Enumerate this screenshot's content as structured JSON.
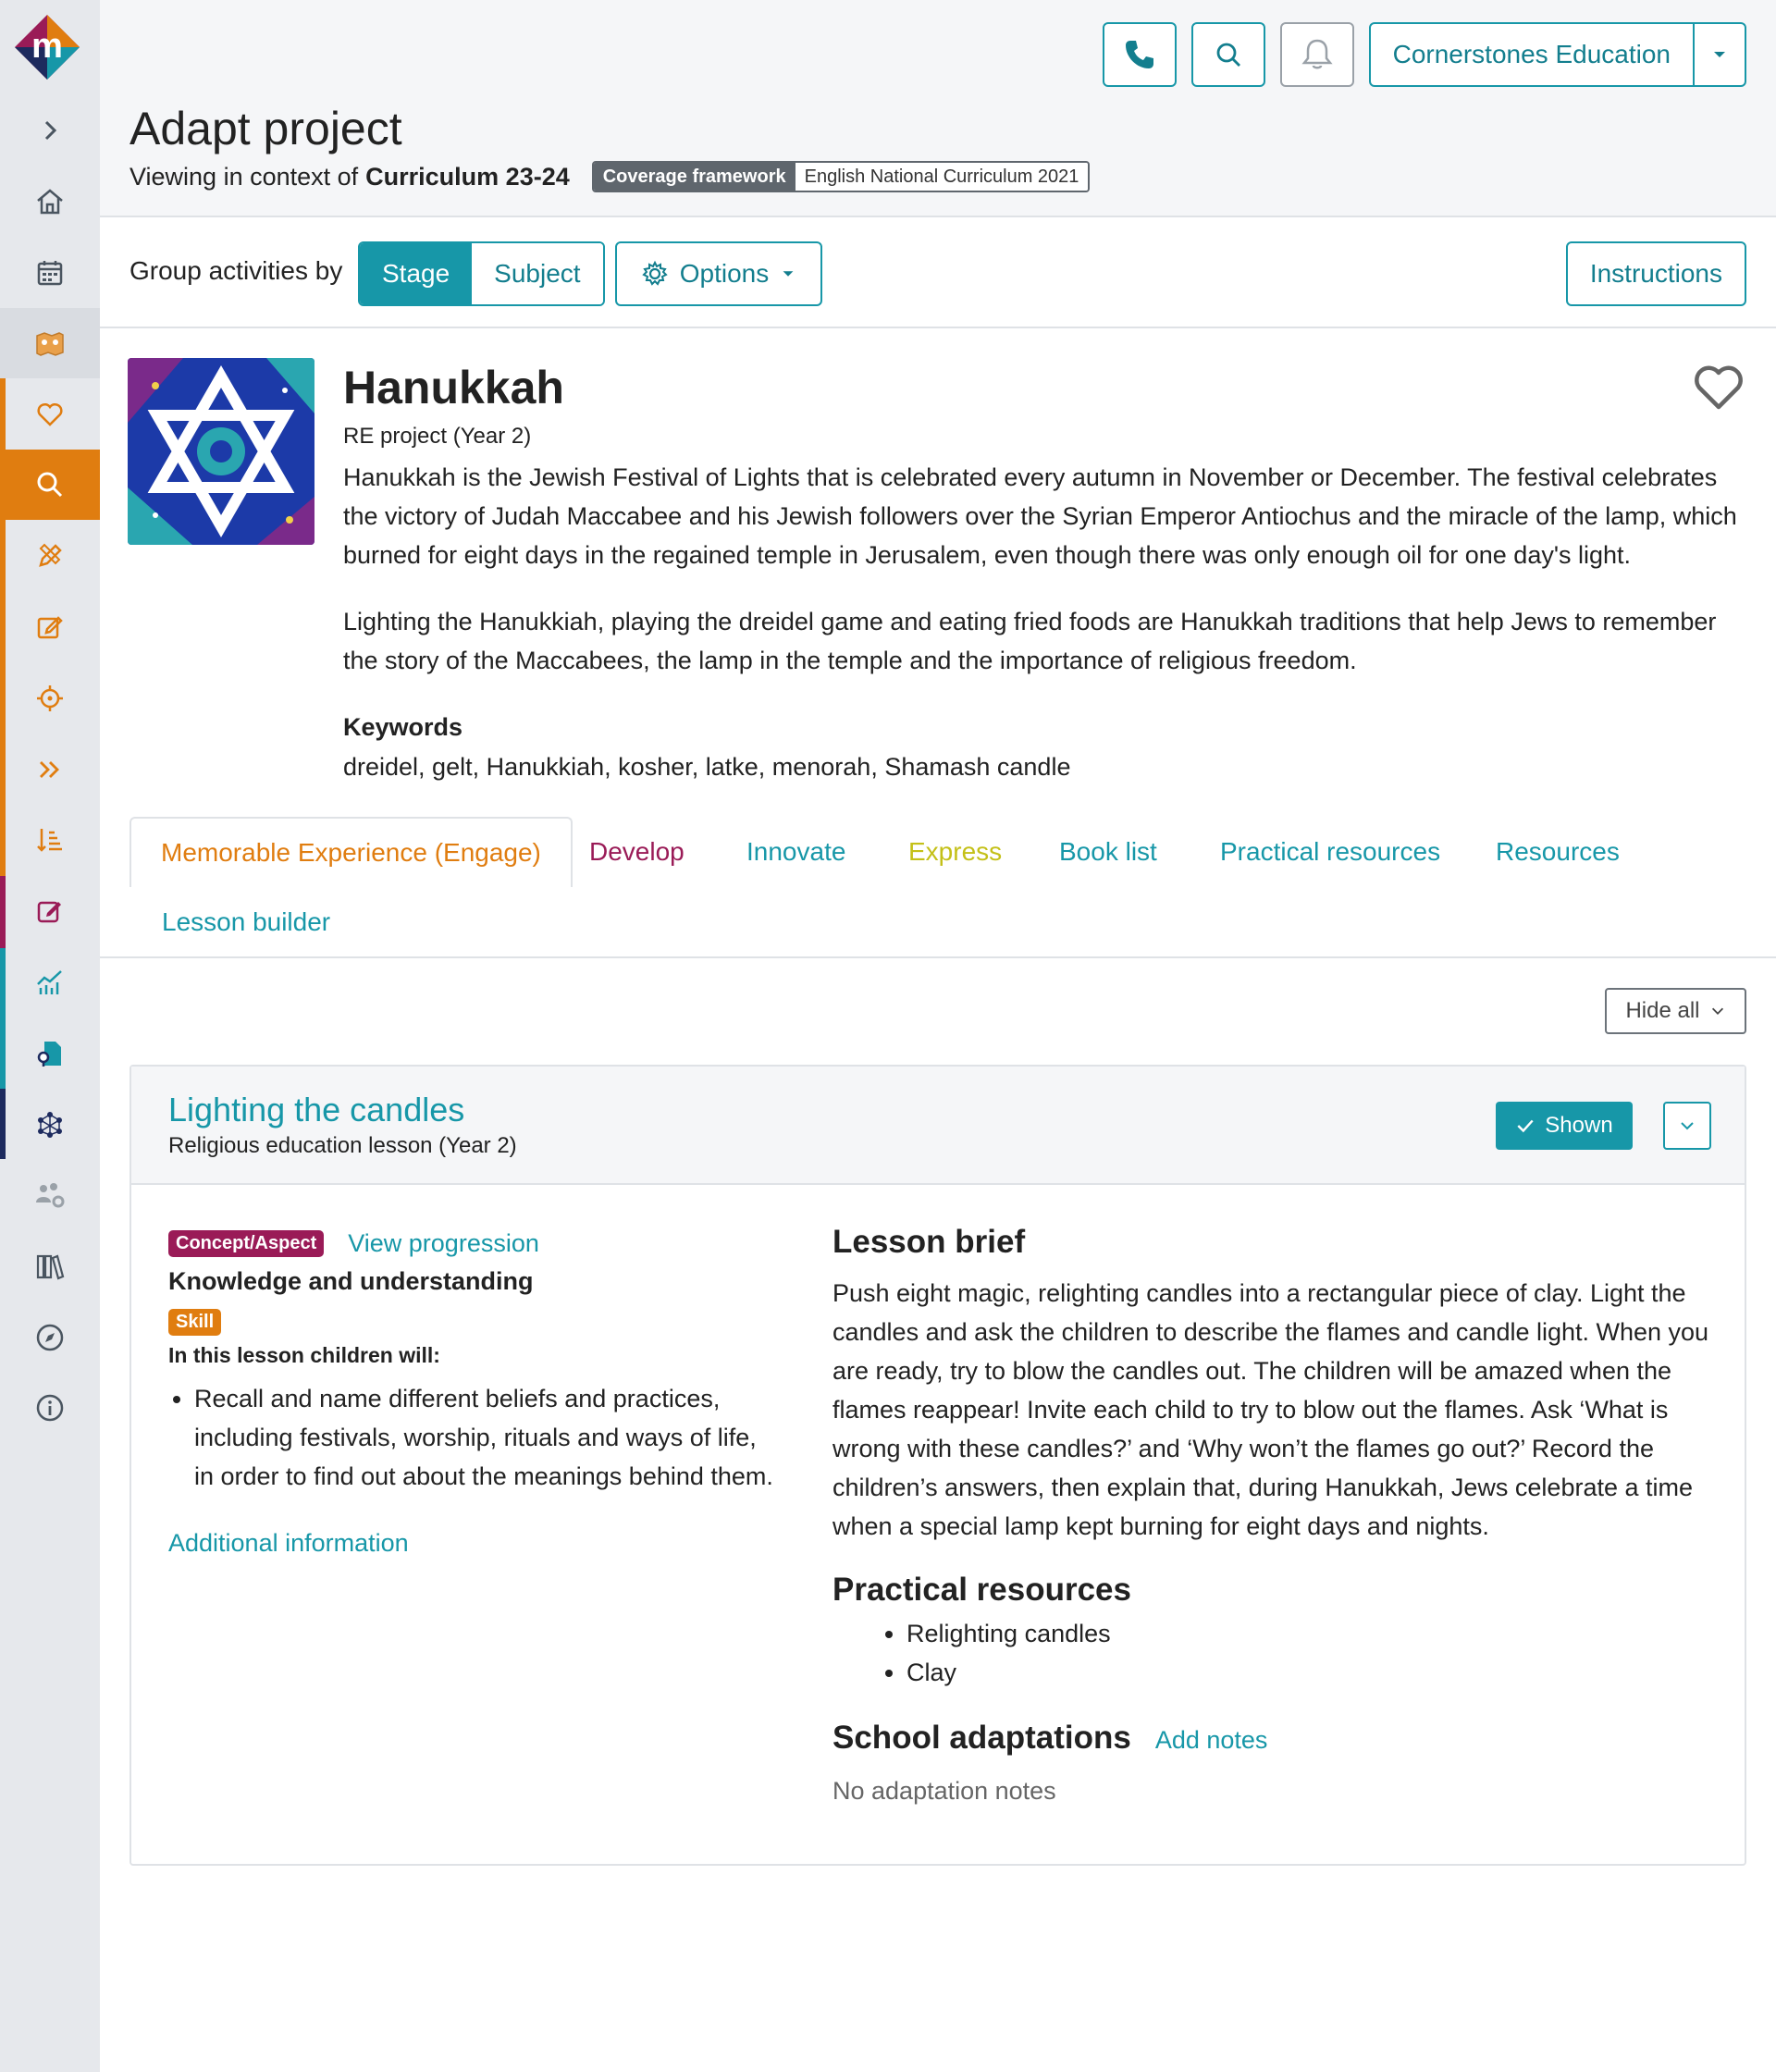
{
  "colors": {
    "teal": "#1797a8",
    "orange": "#e07d10",
    "maroon": "#9a1b57",
    "express": "#c4c018",
    "navy": "#1d2a5e",
    "sidebar_bg": "#e6e8ec"
  },
  "sidebar": {
    "items": [
      {
        "icon": "chevron-right-icon"
      },
      {
        "icon": "home-icon"
      },
      {
        "icon": "calendar-icon"
      },
      {
        "icon": "project-map-icon"
      },
      {
        "icon": "heart-icon"
      },
      {
        "icon": "search-icon",
        "active": true
      },
      {
        "icon": "pencil-ruler-icon"
      },
      {
        "icon": "edit-icon"
      },
      {
        "icon": "target-icon"
      },
      {
        "icon": "double-chevron-icon"
      },
      {
        "icon": "sort-list-icon"
      },
      {
        "icon": "assess-edit-icon"
      },
      {
        "icon": "chart-icon"
      },
      {
        "icon": "file-search-icon"
      },
      {
        "icon": "network-icon"
      },
      {
        "icon": "users-settings-icon"
      },
      {
        "icon": "library-icon"
      },
      {
        "icon": "compass-icon"
      },
      {
        "icon": "info-icon"
      }
    ]
  },
  "header": {
    "school_name": "Cornerstones Education",
    "page_title": "Adapt project",
    "context_prefix": "Viewing in context of",
    "context_name": "Curriculum 23-24",
    "coverage_label": "Coverage framework",
    "coverage_value": "English National Curriculum 2021"
  },
  "groupbar": {
    "label": "Group activities by",
    "stage": "Stage",
    "subject": "Subject",
    "options": "Options",
    "instructions": "Instructions"
  },
  "project": {
    "title": "Hanukkah",
    "subtitle": "RE project (Year 2)",
    "desc1": "Hanukkah is the Jewish Festival of Lights that is celebrated every autumn in November or December. The festival celebrates the victory of Judah Maccabee and his Jewish followers over the Syrian Emperor Antiochus and the miracle of the lamp, which burned for eight days in the regained temple in Jerusalem, even though there was only enough oil for one day's light.",
    "desc2": "Lighting the Hanukkiah, playing the dreidel game and eating fried foods are Hanukkah traditions that help Jews to remember the story of the Maccabees, the lamp in the temple and the importance of religious freedom.",
    "keywords_label": "Keywords",
    "keywords": "dreidel, gelt, Hanukkiah, kosher, latke, menorah, Shamash candle"
  },
  "tabs": {
    "engage": "Memorable Experience (Engage)",
    "develop": "Develop",
    "innovate": "Innovate",
    "express": "Express",
    "book_list": "Book list",
    "practical": "Practical resources",
    "resources": "Resources",
    "lesson_builder": "Lesson builder"
  },
  "hide_all": "Hide all",
  "lesson": {
    "title": "Lighting the candles",
    "subtitle": "Religious education lesson (Year 2)",
    "shown": "Shown",
    "concept_label": "Concept/Aspect",
    "view_progression": "View progression",
    "concept_value": "Knowledge and understanding",
    "skill_label": "Skill",
    "will_label": "In this lesson children will:",
    "will_item": "Recall and name different beliefs and practices, including festivals, worship, rituals and ways of life, in order to find out about the meanings behind them.",
    "additional_info": "Additional information",
    "brief_heading": "Lesson brief",
    "brief": "Push eight magic, relighting candles into a rectangular piece of clay. Light the candles and ask the children to describe the flames and candle light. When you are ready, try to blow the candles out. The children will be amazed when the flames reappear! Invite each child to try to blow out the flames. Ask ‘What is wrong with these candles?’ and ‘Why won’t the flames go out?’ Record the children’s answers, then explain that, during Hanukkah, Jews celebrate a time when a special lamp kept burning for eight days and nights.",
    "practical_heading": "Practical resources",
    "practical_items": [
      "Relighting candles",
      "Clay"
    ],
    "adapt_heading": "School adaptations",
    "add_notes": "Add notes",
    "no_notes": "No adaptation notes"
  }
}
